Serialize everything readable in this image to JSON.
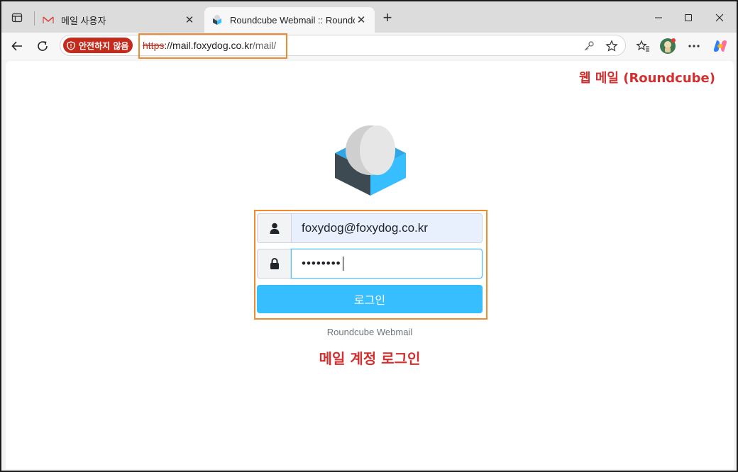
{
  "tabs": [
    {
      "title": "메일 사용자",
      "favicon": "mail-envelope-icon",
      "active": false
    },
    {
      "title": "Roundcube Webmail :: Roundcube Webmail",
      "favicon": "roundcube-icon",
      "active": true
    }
  ],
  "address_bar": {
    "security_label": "안전하지 않음",
    "url_scheme": "https",
    "url_sep": "://",
    "url_host": "mail.foxydog.co.kr",
    "url_path": "/mail/"
  },
  "annotations": {
    "top_right": "웹 메일 (Roundcube)",
    "bottom": "메일 계정 로그인"
  },
  "login": {
    "username_value": "foxydog@foxydog.co.kr",
    "password_value": "••••••••",
    "submit_label": "로그인",
    "product_name": "Roundcube Webmail"
  },
  "colors": {
    "accent": "#37beff",
    "annotation_red": "#d32f2f",
    "highlight_orange": "#ee8a2f",
    "security_red": "#c42b1c"
  }
}
